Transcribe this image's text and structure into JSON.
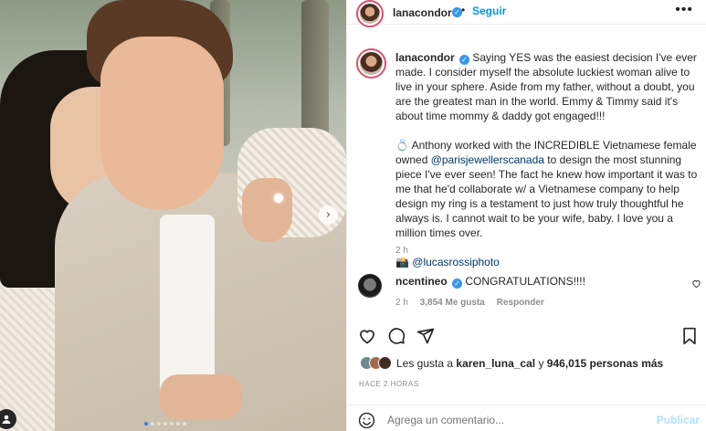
{
  "post": {
    "author": "lanacondor",
    "follow_label": "Seguir",
    "more_label": "•••",
    "separator": "•",
    "verified_glyph": "✓"
  },
  "caption": {
    "username": "lanacondor",
    "paragraph1": "Saying YES was the easiest decision I've ever made. I consider myself the absolute luckiest woman alive to live in your sphere. Aside from my father, without a doubt, you are the greatest man in the world. Emmy & Timmy said it's about time mommy & daddy got engaged!!!",
    "p2_emoji": "💍",
    "p2_part1": "Anthony worked with the INCREDIBLE Vietnamese female owned ",
    "p2_mention": "@parisjewellerscanada",
    "p2_part2": " to design the most stunning piece I've ever seen! The fact he knew how important it was to me that he'd collaborate w/ a Vietnamese company to help design my ring is a testament to just how truly thoughtful he always is. I cannot wait to be your wife, baby. I love you a million times over.",
    "p3_emoji": "📸",
    "p3_mention": "@lucasrossiphoto",
    "time": "2 h"
  },
  "comment": {
    "username": "ncentineo",
    "text": "CONGRATULATIONS!!!!",
    "time": "2 h",
    "likes": "3,854 Me gusta",
    "reply_label": "Responder"
  },
  "likes": {
    "prefix": "Les gusta a",
    "user": "karen_luna_cal",
    "connector": "y",
    "count": "946,015 personas más"
  },
  "posted_ago": "HACE 2 HORAS",
  "add_comment": {
    "placeholder": "Agrega un comentario...",
    "publish_label": "Publicar"
  },
  "carousel": {
    "next_glyph": "›",
    "active_index": 0,
    "slide_count": 7
  },
  "colors": {
    "accent_blue": "#0095f6",
    "verified_blue": "#3897f0",
    "publish_disabled": "#b2dffc",
    "mention": "#00376b"
  }
}
